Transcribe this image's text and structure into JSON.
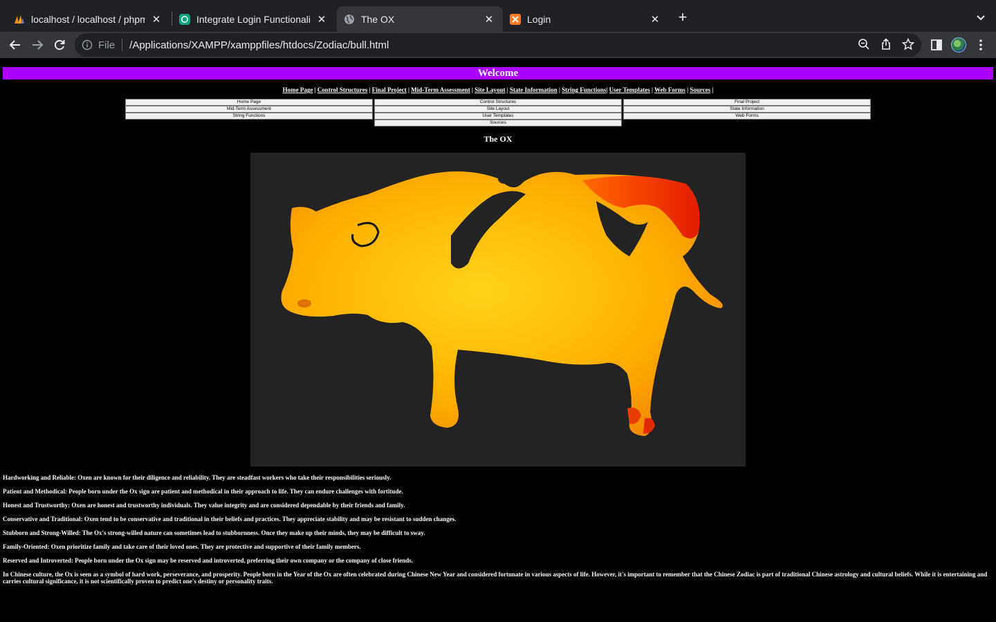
{
  "browser": {
    "tabs": [
      {
        "title": "localhost / localhost / phpmyadmin",
        "icon": "phpmyadmin-icon",
        "active": false
      },
      {
        "title": "Integrate Login Functionality",
        "icon": "chatgpt-icon",
        "active": false
      },
      {
        "title": "The OX",
        "icon": "globe-icon",
        "active": true
      },
      {
        "title": "Login",
        "icon": "xampp-icon",
        "active": false
      }
    ],
    "address_scheme": "File",
    "address_url": "/Applications/XAMPP/xamppfiles/htdocs/Zodiac/bull.html"
  },
  "page": {
    "welcome": "Welcome",
    "top_links": [
      "Home Page",
      "Control Structures",
      "Final Project",
      "Mid-Term Assessment",
      "Site Layout",
      "State Information",
      "String Functions",
      "User Templates",
      "Web Forms",
      "Sources"
    ],
    "buttons": [
      "Home Page",
      "Control Structures",
      "Final Project",
      "Mid-Term Assessment",
      "Site Layout",
      "State Information",
      "String Functions",
      "User Templates",
      "Web Forms",
      "Sources"
    ],
    "heading": "The OX",
    "traits": [
      "Hardworking and Reliable: Oxen are known for their diligence and reliability. They are steadfast workers who take their responsibilities seriously.",
      "Patient and Methodical: People born under the Ox sign are patient and methodical in their approach to life. They can endure challenges with fortitude.",
      "Honest and Trustworthy: Oxen are honest and trustworthy individuals. They value integrity and are considered dependable by their friends and family.",
      "Conservative and Traditional: Oxen tend to be conservative and traditional in their beliefs and practices. They appreciate stability and may be resistant to sudden changes.",
      "Stubborn and Strong-Willed: The Ox's strong-willed nature can sometimes lead to stubbornness. Once they make up their minds, they may be difficult to sway.",
      "Family-Oriented: Oxen prioritize family and take care of their loved ones. They are protective and supportive of their family members.",
      "Reserved and Introverted: People born under the Ox sign may be reserved and introverted, preferring their own company or the company of close friends.",
      "In Chinese culture, the Ox is seen as a symbol of hard work, perseverance, and prosperity. People born in the Year of the Ox are often celebrated during Chinese New Year and considered fortunate in various aspects of life. However, it's important to remember that the Chinese Zodiac is part of traditional Chinese astrology and cultural beliefs. While it is entertaining and carries cultural significance, it is not scientifically proven to predict one's destiny or personality traits."
    ]
  }
}
